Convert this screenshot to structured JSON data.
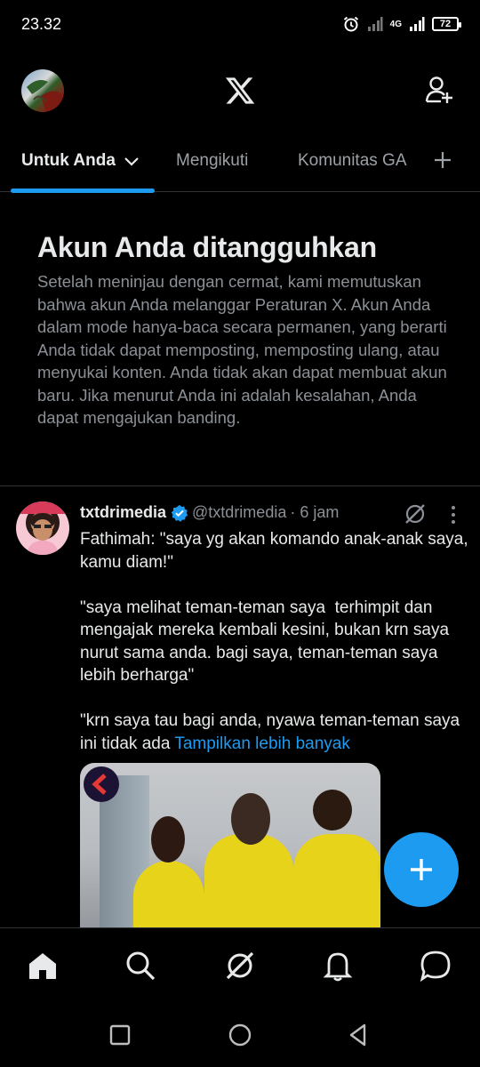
{
  "status_bar": {
    "time": "23.32",
    "network": "4G",
    "battery": "72"
  },
  "header": {
    "logo": "x-logo-icon",
    "account_icon": "avatar",
    "add_user_icon": "add-user-icon"
  },
  "tabs": [
    {
      "label": "Untuk Anda",
      "active": true
    },
    {
      "label": "Mengikuti",
      "active": false
    },
    {
      "label": "Komunitas GA",
      "active": false
    }
  ],
  "notice": {
    "title": "Akun Anda ditangguhkan",
    "body": "Setelah meninjau dengan cermat, kami memutuskan bahwa akun Anda melanggar Peraturan X. Akun Anda dalam mode hanya-baca secara permanen, yang berarti Anda tidak dapat memposting, memposting ulang, atau menyukai konten. Anda tidak akan dapat membuat akun baru. Jika menurut Anda ini adalah kesalahan, Anda dapat mengajukan banding."
  },
  "tweet": {
    "name": "txtdrimedia",
    "handle": "@txtdrimedia",
    "time": "· 6 jam",
    "text": "Fathimah: \"saya yg akan komando anak-anak saya, kamu diam!\"\n\n\"saya melihat teman-teman saya  terhimpit dan mengajak mereka kembali kesini, bukan krn saya nurut sama anda. bagi saya, teman-teman saya lebih berharga\"\n\n\"krn saya tau bagi anda, nyawa teman-teman saya ini tidak ada ",
    "show_more": "Tampilkan lebih banyak"
  },
  "colors": {
    "accent": "#1d9bf0",
    "background": "#000000",
    "muted": "#8b9096",
    "media_jacket": "#e8d31b"
  },
  "bottom_nav": [
    "home-icon",
    "search-icon",
    "grok-icon",
    "notifications-icon",
    "messages-icon"
  ],
  "system_nav": [
    "recents-icon",
    "home-circle-icon",
    "back-icon"
  ]
}
